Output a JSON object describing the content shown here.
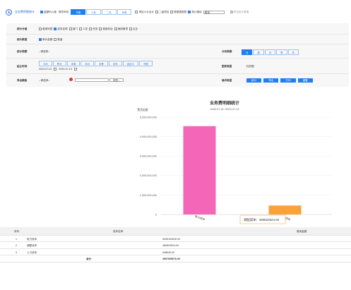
{
  "topbar": {
    "title": "业务费明细统计",
    "options": [
      "金额列入账",
      "财务年份"
    ],
    "year_chips": [
      {
        "label": "不限",
        "active": true
      },
      {
        "label": "三年",
        "active": false
      },
      {
        "label": "二年",
        "active": false
      },
      {
        "label": "年审",
        "active": false
      }
    ],
    "checks": [
      "项目小计合计",
      "二级项目",
      "数据透视表"
    ],
    "stat_option": "统计指标",
    "select_value": "费用",
    "radio_label": "项目统计数据"
  },
  "form": {
    "stat_dim_label": "统计分维",
    "stat_dims": [
      {
        "label": "费用列表",
        "checked": false
      },
      {
        "label": "成本名称",
        "checked": true
      },
      {
        "label": "部门",
        "checked": false
      },
      {
        "label": "人员",
        "checked": false
      },
      {
        "label": "任务",
        "checked": false
      },
      {
        "label": "费用科目",
        "checked": false
      },
      {
        "label": "使用事项",
        "checked": false
      },
      {
        "label": "企业",
        "checked": false
      }
    ],
    "stat_data_label": "统计数据",
    "stat_data": [
      {
        "label": "单价金额",
        "checked": true
      },
      {
        "label": "数量",
        "checked": false
      }
    ],
    "stat_period_label": "统计周期",
    "stat_period_value": "--请选择--",
    "time_unit_label": "分析周期",
    "time_units": [
      {
        "label": "日",
        "active": true
      },
      {
        "label": "周",
        "active": false
      },
      {
        "label": "月",
        "active": false
      },
      {
        "label": "季",
        "active": false
      },
      {
        "label": "年",
        "active": false
      }
    ],
    "date_label": "起止时间",
    "date_chips": [
      "今天",
      "昨天",
      "本周",
      "本月",
      "本季",
      "本年",
      "自定义",
      "不限"
    ],
    "date_from": "2023-07-01",
    "date_to": "2023-07-19",
    "chart_type_label": "图表类型",
    "chart_type_value": "柱状图",
    "export_label": "导出模板",
    "export_value": "--请选择--",
    "browse_label": "浏览...",
    "ops_label": "操作类型",
    "ops": [
      "统计",
      "导出",
      "打印",
      "重置"
    ]
  },
  "chart_data": {
    "type": "bar",
    "title": "业务费明细统计",
    "subtitle": "2023-07-01~2023-07-19",
    "ylabel": "费用金额",
    "categories": [
      "电力成本",
      "调配成本"
    ],
    "values": [
      4536163526,
      460823524
    ],
    "colors": [
      "#f466b8",
      "#f9a23a"
    ],
    "ylim": [
      0,
      5000000000
    ],
    "yticks": [
      "0",
      "1,000,000,000",
      "2,000,000,000",
      "3,000,000,000",
      "4,000,000,000",
      "5,000,000,000"
    ],
    "tooltip": "调配成本：460823524.00"
  },
  "table": {
    "headers": [
      "序号",
      "成本名称",
      "费用金额"
    ],
    "rows": [
      {
        "no": "1",
        "name": "电力成本",
        "amount": "4536163526.00"
      },
      {
        "no": "2",
        "name": "调配成本",
        "amount": "460823524.00"
      },
      {
        "no": "3",
        "name": "人力成本",
        "amount": "948626.00"
      }
    ],
    "total_label": "合计",
    "total_amount": "4997935676.00"
  }
}
